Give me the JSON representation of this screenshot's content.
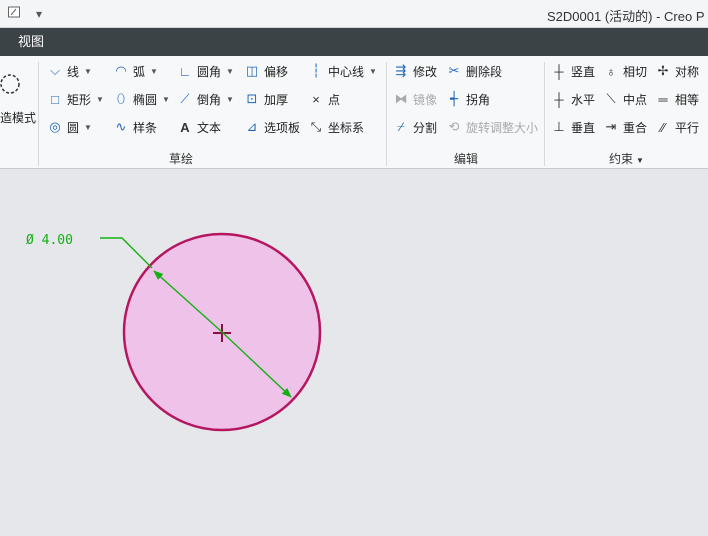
{
  "window": {
    "title": "S2D0001 (活动的) - Creo P"
  },
  "quick_access": {
    "dropdown_glyph": "▾"
  },
  "menubar": {
    "active_tab": "视图"
  },
  "ribbon": {
    "mode_button": {
      "label": "造模式"
    },
    "sketch_group": {
      "label": "草绘",
      "buttons": {
        "line": "线",
        "arc": "弧",
        "fillet": "圆角",
        "offset": "偏移",
        "centerline": "中心线",
        "rectangle": "矩形",
        "ellipse": "椭圆",
        "chamfer": "倒角",
        "thicken": "加厚",
        "point": "点",
        "circle": "圆",
        "spline": "样条",
        "text": "文本",
        "palette": "选项板",
        "coordsys": "坐标系"
      }
    },
    "edit_group": {
      "label": "编辑",
      "buttons": {
        "modify": "修改",
        "delete_segment": "删除段",
        "mirror": "镜像",
        "corner": "拐角",
        "divide": "分割",
        "rotate_resize": "旋转调整大小"
      }
    },
    "constrain_group": {
      "label": "约束",
      "buttons": {
        "vertical": "竖直",
        "tangent": "相切",
        "symmetric": "对称",
        "horizontal": "水平",
        "midpoint": "中点",
        "equal": "相等",
        "perpendicular": "垂直",
        "coincident": "重合",
        "parallel": "平行"
      }
    }
  },
  "sketch": {
    "dimension_label": "Ø 4.00",
    "diameter": 4.0,
    "colors": {
      "circle_fill": "#efc2ea",
      "circle_stroke": "#b5165f",
      "dimension": "#12b012",
      "center_mark": "#8a1040"
    }
  }
}
